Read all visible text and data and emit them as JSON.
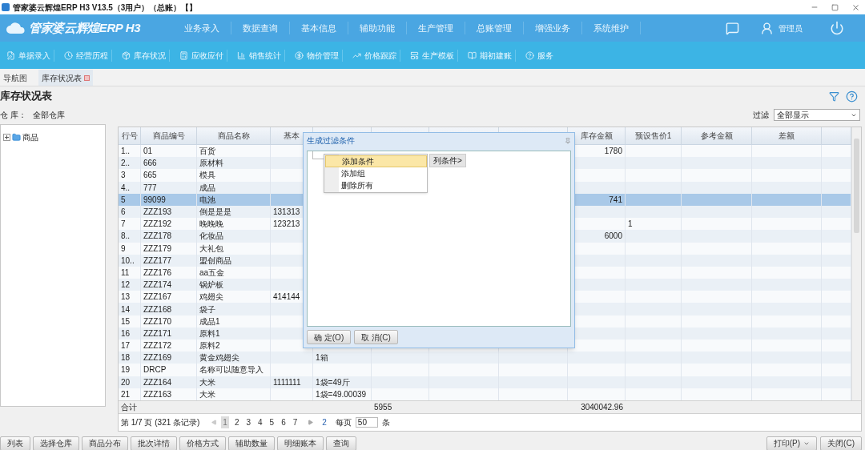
{
  "window": {
    "title": "管家婆云辉煌ERP H3 V13.5（3用户）（总账）【】"
  },
  "header": {
    "logo": "管家婆云辉煌ERP H3",
    "menu": [
      "业务录入",
      "数据查询",
      "基本信息",
      "辅助功能",
      "生产管理",
      "总账管理",
      "增强业务",
      "系统维护"
    ],
    "user": "管理员"
  },
  "toolbar": [
    "单据录入",
    "经营历程",
    "库存状况",
    "应收应付",
    "销售统计",
    "物价管理",
    "价格跟踪",
    "生产模板",
    "期初建账",
    "服务"
  ],
  "tabs": [
    {
      "label": "导航图",
      "selected": false,
      "closable": false
    },
    {
      "label": "库存状况表",
      "selected": true,
      "closable": true
    }
  ],
  "page": {
    "title": "库存状况表",
    "warehouse_label": "仓 库：",
    "warehouse": "全部仓库",
    "filter_label": "过滤",
    "filter_value": "全部显示"
  },
  "tree": [
    {
      "label": "商品",
      "expanded": false
    }
  ],
  "table": {
    "columns": {
      "row_no": "行号",
      "code": "商品编号",
      "name": "商品名称",
      "barcode": "基本",
      "stock_amount": "库存金额",
      "price_1": "预设售价1",
      "ref_amount": "参考金额",
      "difference": "差额"
    },
    "rows": [
      {
        "row_no": "1..",
        "code": "01",
        "name": "百货",
        "stock_amount": "1780",
        "selected": false
      },
      {
        "row_no": "2..",
        "code": "666",
        "name": "原材料",
        "selected": false
      },
      {
        "row_no": "3",
        "code": "665",
        "name": "模具",
        "selected": false
      },
      {
        "row_no": "4..",
        "code": "777",
        "name": "成品",
        "selected": false
      },
      {
        "row_no": "5",
        "code": "99099",
        "name": "电池",
        "stock_amount": "741",
        "selected": true
      },
      {
        "row_no": "6",
        "code": "ZZZ193",
        "name": "倒是是是",
        "barcode": "131313",
        "selected": false
      },
      {
        "row_no": "7",
        "code": "ZZZ192",
        "name": "晚晚晚",
        "barcode": "123213",
        "price_1": "1",
        "selected": false
      },
      {
        "row_no": "8..",
        "code": "ZZZ178",
        "name": "化妆品",
        "stock_amount": "6000",
        "selected": false
      },
      {
        "row_no": "9",
        "code": "ZZZ179",
        "name": "大礼包",
        "selected": false
      },
      {
        "row_no": "10..",
        "code": "ZZZ177",
        "name": "盟创商品",
        "selected": false
      },
      {
        "row_no": "11",
        "code": "ZZZ176",
        "name": "aa五金",
        "selected": false
      },
      {
        "row_no": "12",
        "code": "ZZZ174",
        "name": "锅炉板",
        "selected": false
      },
      {
        "row_no": "13",
        "code": "ZZZ167",
        "name": "鸡翅尖",
        "barcode": "414144",
        "selected": false
      },
      {
        "row_no": "14",
        "code": "ZZZ168",
        "name": "袋子",
        "selected": false
      },
      {
        "row_no": "15",
        "code": "ZZZ170",
        "name": "成品1",
        "selected": false
      },
      {
        "row_no": "16",
        "code": "ZZZ171",
        "name": "原料1",
        "selected": false
      },
      {
        "row_no": "17",
        "code": "ZZZ172",
        "name": "原料2",
        "selected": false
      },
      {
        "row_no": "18",
        "code": "ZZZ169",
        "name": "黄金鸡翅尖",
        "column_5": "1箱",
        "selected": false
      },
      {
        "row_no": "19",
        "code": "DRCP",
        "name": "名称可以随意导入",
        "selected": false
      },
      {
        "row_no": "20",
        "code": "ZZZ164",
        "name": "大米",
        "barcode": "1111111",
        "column_5": "1袋=49斤",
        "selected": false
      },
      {
        "row_no": "21",
        "code": "ZZZ163",
        "name": "大米",
        "column_5": "1袋=49.00039",
        "selected": false
      }
    ],
    "total": {
      "row_no": "合计",
      "column_6": "5955",
      "stock_amount": "3040042.96"
    }
  },
  "pager": {
    "summary": "第 1/7 页 (321 条记录)",
    "pages": [
      {
        "label": "1",
        "selected": true
      },
      {
        "label": "2",
        "selected": false
      },
      {
        "label": "3",
        "selected": false
      },
      {
        "label": "4",
        "selected": false
      },
      {
        "label": "5",
        "selected": false
      },
      {
        "label": "6",
        "selected": false
      },
      {
        "label": "7",
        "selected": false
      }
    ],
    "goto": "2",
    "per_page_label": "每页",
    "per_page": "50",
    "unit": "条"
  },
  "dialog": {
    "title": "生成过滤条件",
    "condition_button": "列条件>",
    "menu": [
      {
        "label": "添加条件",
        "selected": true
      },
      {
        "label": "添加组",
        "selected": false
      },
      {
        "label": "删除所有",
        "selected": false
      }
    ],
    "buttons": [
      "确 定(O)",
      "取 消(C)"
    ]
  },
  "buttons": [
    "列表",
    "选择仓库",
    "商品分布",
    "批次详情",
    "价格方式",
    "辅助数量",
    "明细账本",
    "查询"
  ],
  "right_buttons": [
    {
      "label": "打印(P)",
      "dropdown": true
    },
    {
      "label": "关闭(C)",
      "dropdown": false
    }
  ]
}
